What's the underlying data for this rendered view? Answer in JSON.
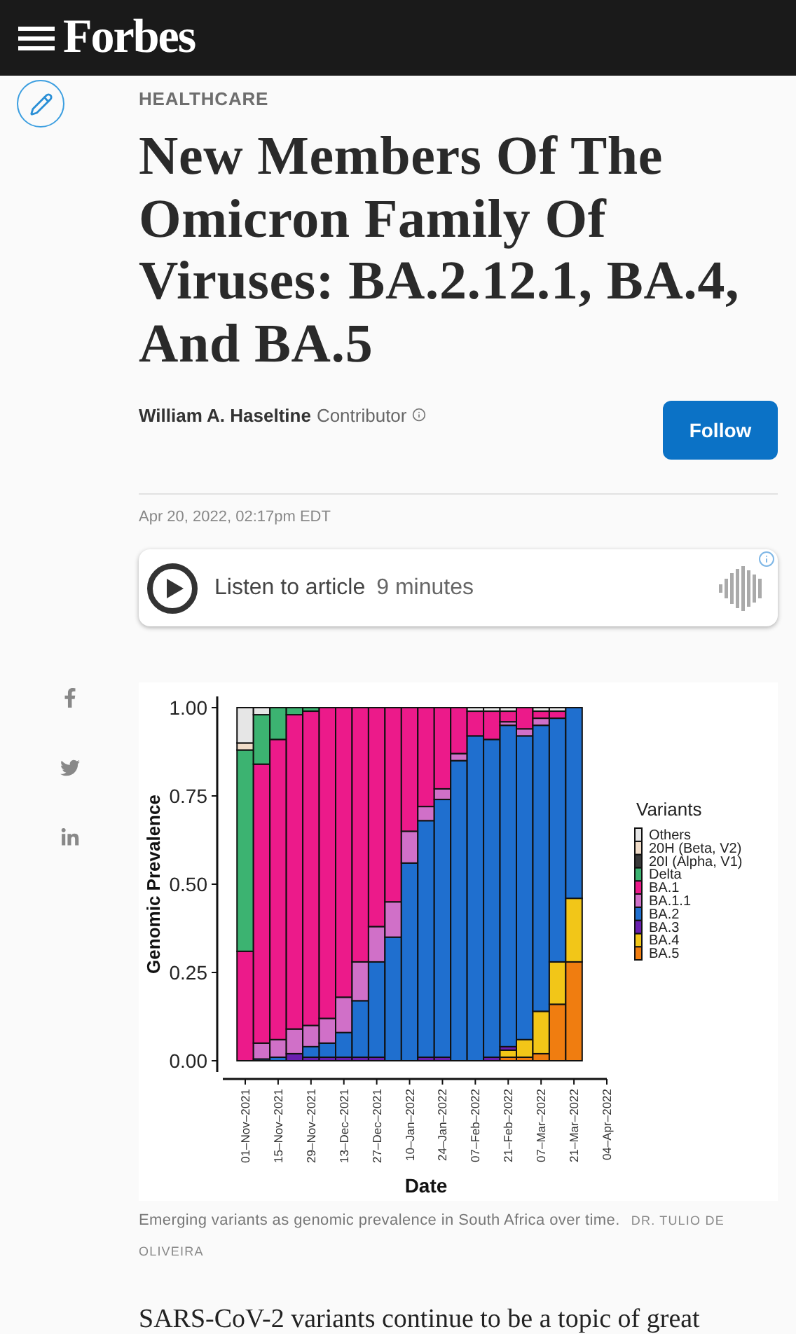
{
  "header": {
    "logo": "Forbes"
  },
  "article": {
    "section": "HEALTHCARE",
    "title": "New Members Of The Omicron Family Of Viruses: BA.2.12.1, BA.4, And BA.5",
    "author": {
      "name": "William A. Haseltine",
      "role": "Contributor"
    },
    "follow_button": "Follow",
    "date": "Apr 20, 2022, 02:17pm EDT",
    "audio_player": {
      "label": "Listen to article",
      "duration": "9 minutes"
    },
    "share": [
      {
        "kind": "facebook"
      },
      {
        "kind": "twitter"
      },
      {
        "kind": "linkedin"
      }
    ],
    "figure": {
      "chart_data": {
        "type": "bar",
        "stacked": true,
        "xlabel": "Date",
        "ylabel": "Genomic Prevalence",
        "legend": {
          "title": "Variants"
        },
        "categories": [
          "01–Nov–2021",
          null,
          "15–Nov–2021",
          null,
          "29–Nov–2021",
          null,
          "13–Dec–2021",
          null,
          "27–Dec–2021",
          null,
          "10–Jan–2022",
          null,
          "24–Jan–2022",
          null,
          "07–Feb–2022",
          null,
          "21–Feb–2022",
          null,
          "07–Mar–2022",
          null,
          "21–Mar–2022",
          null,
          "04–Apr–2022"
        ],
        "ylim": [
          0,
          1
        ],
        "yticks": [
          {
            "value": 0,
            "label": "0.00"
          },
          {
            "value": 0.25,
            "label": "0.25"
          },
          {
            "value": 0.5,
            "label": "0.50"
          },
          {
            "value": 0.75,
            "label": "0.75"
          },
          {
            "value": 1,
            "label": "1.00"
          }
        ],
        "series": [
          {
            "name": "BA.5",
            "color": "#f07d10",
            "values": [
              0,
              0,
              0,
              0,
              0,
              0,
              0,
              0,
              0,
              0,
              0,
              0,
              0,
              0,
              0,
              0,
              0.01,
              0.01,
              0.02,
              0.16,
              0.28,
              null,
              null
            ]
          },
          {
            "name": "BA.4",
            "color": "#f2c618",
            "values": [
              0,
              0,
              0,
              0,
              0,
              0,
              0,
              0,
              0,
              0,
              0,
              0,
              0,
              0,
              0,
              0,
              0.02,
              0.05,
              0.12,
              0.12,
              0.18,
              null,
              null
            ]
          },
          {
            "name": "BA.3",
            "color": "#6a1fb0",
            "values": [
              0,
              0,
              0,
              0.02,
              0.01,
              0.01,
              0.01,
              0.01,
              0.01,
              0,
              0,
              0.01,
              0.01,
              0,
              0,
              0.01,
              0.01,
              0,
              0,
              0,
              0,
              null,
              null
            ]
          },
          {
            "name": "BA.2",
            "color": "#1f6fcf",
            "values": [
              0,
              0.005,
              0.01,
              0,
              0.03,
              0.04,
              0.07,
              0.16,
              0.27,
              0.35,
              0.56,
              0.67,
              0.73,
              0.85,
              0.92,
              0.9,
              0.91,
              0.86,
              0.81,
              0.69,
              0.54,
              null,
              null
            ]
          },
          {
            "name": "BA.1.1",
            "color": "#d070c8",
            "values": [
              0,
              0.045,
              0.05,
              0.07,
              0.06,
              0.07,
              0.1,
              0.11,
              0.1,
              0.1,
              0.09,
              0.04,
              0.03,
              0.02,
              0,
              0,
              0.01,
              0.02,
              0.02,
              0,
              0,
              null,
              null
            ]
          },
          {
            "name": "BA.1",
            "color": "#ec1a8a",
            "values": [
              0.31,
              0.79,
              0.85,
              0.89,
              0.89,
              0.88,
              0.82,
              0.72,
              0.62,
              0.55,
              0.35,
              0.28,
              0.23,
              0.13,
              0.07,
              0.08,
              0.03,
              0.06,
              0.02,
              0.02,
              0,
              null,
              null
            ]
          },
          {
            "name": "Delta",
            "color": "#3cb371",
            "values": [
              0.57,
              0.14,
              0.09,
              0.02,
              0.01,
              0,
              0,
              0,
              0,
              0,
              0,
              0,
              0,
              0,
              0,
              0,
              0,
              0,
              0,
              0,
              0,
              null,
              null
            ]
          },
          {
            "name": "20I (Alpha, V1)",
            "color": "#3a3a3a",
            "values": [
              0,
              0,
              0,
              0,
              0,
              0,
              0,
              0,
              0,
              0,
              0,
              0,
              0,
              0,
              0,
              0,
              0,
              0,
              0,
              0,
              0,
              null,
              null
            ]
          },
          {
            "name": "20H (Beta, V2)",
            "color": "#f0dcc8",
            "values": [
              0.02,
              0,
              0,
              0,
              0,
              0,
              0,
              0,
              0,
              0,
              0,
              0,
              0,
              0,
              0,
              0,
              0,
              0,
              0,
              0,
              0,
              null,
              null
            ]
          },
          {
            "name": "Others",
            "color": "#e6e6e6",
            "values": [
              0.1,
              0.02,
              0,
              0,
              0,
              0,
              0,
              0,
              0,
              0,
              0,
              0,
              0,
              0,
              0.01,
              0.01,
              0.01,
              0,
              0.01,
              0.01,
              0,
              null,
              null
            ]
          }
        ]
      },
      "caption": "Emerging variants as genomic prevalence in South Africa over time.",
      "credit": "DR. TULIO DE OLIVEIRA"
    },
    "body": "SARS-CoV-2 variants continue to be a topic of great"
  }
}
